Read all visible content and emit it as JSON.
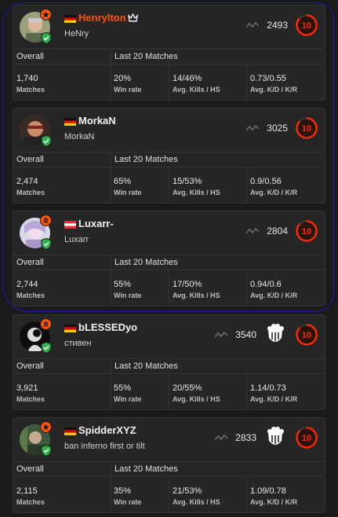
{
  "colors": {
    "accent": "#ff5500",
    "shield": "#2fb24a",
    "annotation": "#1a1fb5"
  },
  "labels": {
    "overall": "Overall",
    "last20": "Last 20 Matches",
    "matches": "Matches",
    "win_rate": "Win rate",
    "avg_kills_hs": "Avg. Kills / HS",
    "avg_kd_kr": "Avg. K/D / K/R"
  },
  "players": [
    {
      "name": "Henrylton",
      "subtitle": "HeNry",
      "elo": "2493",
      "level": "10",
      "flag": "germany",
      "highlighted_name": true,
      "crown_icon": true,
      "matches": "1,740",
      "win_rate": "20%",
      "avg_kills_hs": "14/46%",
      "avg_kd_kr": "0.73/0.55"
    },
    {
      "name": "MorkaN",
      "subtitle": "MorkaN",
      "elo": "3025",
      "level": "10",
      "flag": "germany",
      "matches": "2,474",
      "win_rate": "65%",
      "avg_kills_hs": "15/53%",
      "avg_kd_kr": "0.9/0.56"
    },
    {
      "name": "Luxarr-",
      "subtitle": "Luxarr",
      "elo": "2804",
      "level": "10",
      "flag": "austria",
      "matches": "2,744",
      "win_rate": "55%",
      "avg_kills_hs": "17/50%",
      "avg_kd_kr": "0.94/0.6"
    },
    {
      "name": "bLESSEDyo",
      "subtitle": "стивен",
      "elo": "3540",
      "level": "10",
      "flag": "germany",
      "team_logo": "bds-logo",
      "matches": "3,921",
      "win_rate": "55%",
      "avg_kills_hs": "20/55%",
      "avg_kd_kr": "1.14/0.73"
    },
    {
      "name": "SpidderXYZ",
      "subtitle": "ban inferno first or tilt",
      "elo": "2833",
      "level": "10",
      "flag": "germany",
      "team_logo": "bds-logo",
      "matches": "2,115",
      "win_rate": "35%",
      "avg_kills_hs": "21/53%",
      "avg_kd_kr": "1.09/0.78"
    }
  ]
}
